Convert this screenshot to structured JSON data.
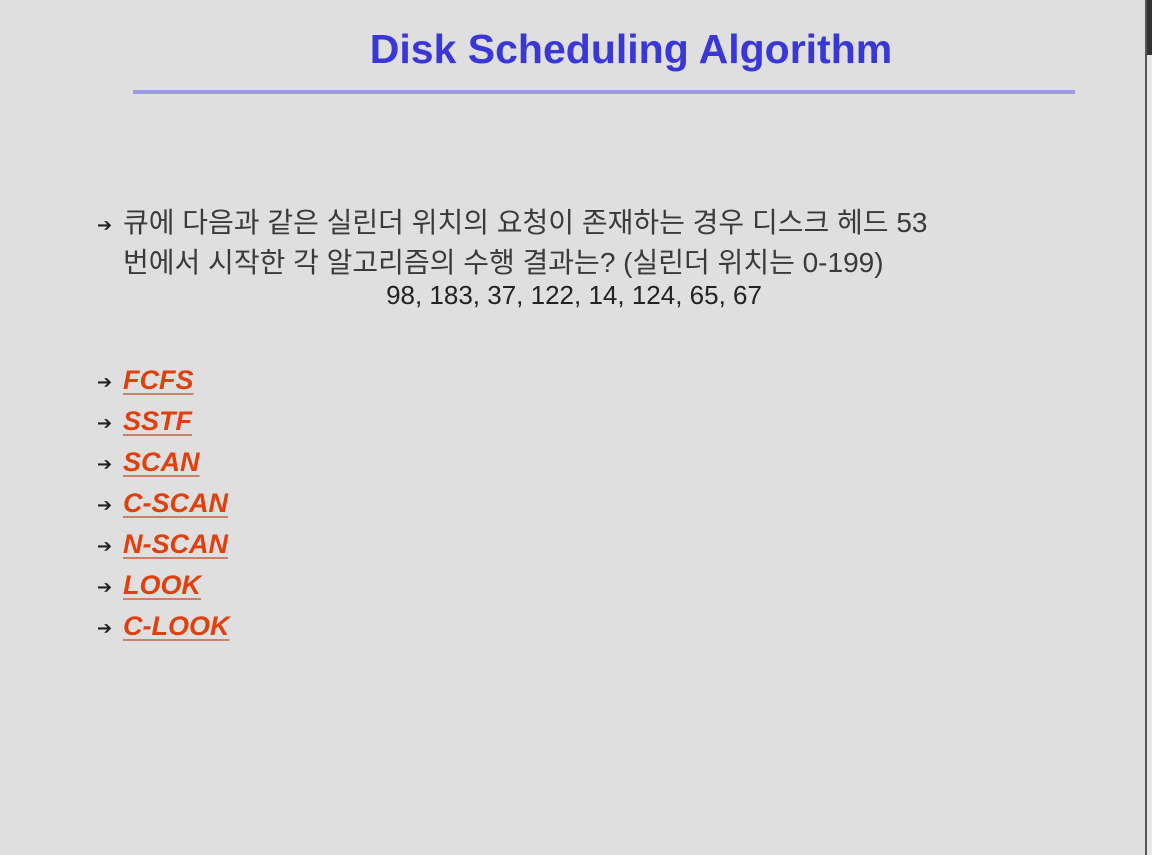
{
  "slide": {
    "title": "Disk Scheduling Algorithm",
    "question_line1": "큐에 다음과 같은 실린더 위치의 요청이 존재하는 경우 디스크 헤드 53",
    "question_line2": "번에서 시작한 각 알고리즘의 수행 결과는? (실린더 위치는 0-199)",
    "queue": "98, 183, 37, 122, 14, 124, 65, 67",
    "bullet_icon": "arrow-bullet-icon",
    "algorithms": [
      "FCFS",
      "SSTF",
      "SCAN",
      "C-SCAN",
      "N-SCAN",
      "LOOK",
      "C-LOOK"
    ],
    "colors": {
      "title": "#3a37d8",
      "link": "#e0400d",
      "background": "#dfdfdf"
    }
  }
}
